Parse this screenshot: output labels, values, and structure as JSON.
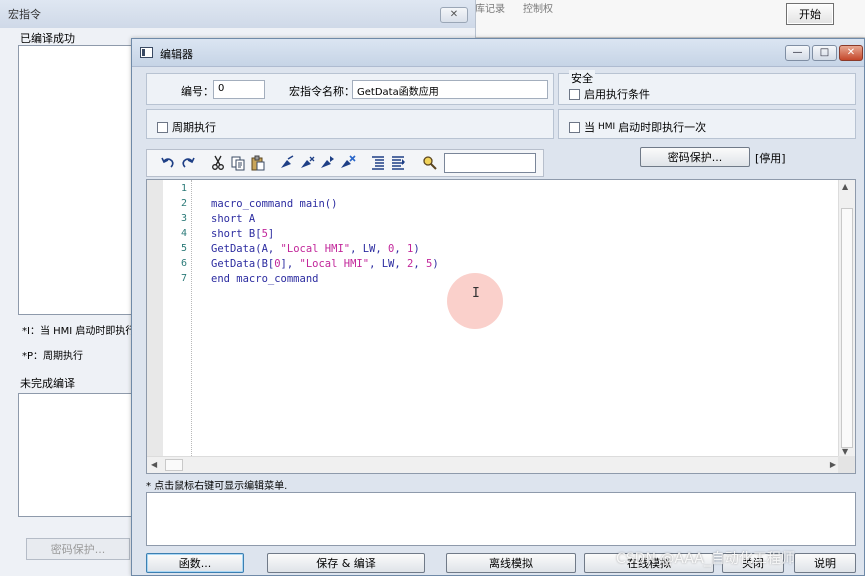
{
  "background_app": {
    "tabs": [
      "库记录",
      "控制权"
    ],
    "start_button": "开始"
  },
  "macro_window": {
    "title": "宏指令",
    "close_icon": "close-icon",
    "compiled_label": "已编译成功",
    "note_i": "*I：当 HMI 启动时即执行",
    "note_p": "*P：周期执行",
    "not_compiled_label": "未完成编译",
    "password_button": "密码保护..."
  },
  "editor": {
    "title": "编辑器",
    "window_controls": {
      "minimize": "—",
      "maximize": "□",
      "close": "✕"
    },
    "id_label": "编号：",
    "id_value": "0",
    "name_label": "宏指令名称：",
    "name_value": "GetData函数应用",
    "security_label": "安全",
    "enable_condition_label": "启用执行条件",
    "periodic_label": "周期执行",
    "run_once_prefix": "当",
    "run_once_hmi": "HMI",
    "run_once_suffix": "启动时即执行一次",
    "password_button": "密码保护...",
    "disabled_tag": "[停用]",
    "toolbar_icons": [
      "undo-icon",
      "redo-icon",
      "cut-icon",
      "copy-icon",
      "paste-icon",
      "bookmark-toggle-icon",
      "bookmark-next-icon",
      "bookmark-prev-icon",
      "bookmark-clear-icon",
      "indent-icon",
      "outdent-icon",
      "find-icon"
    ],
    "search_value": "",
    "code": {
      "line_numbers": [
        "1",
        "2",
        "3",
        "4",
        "5",
        "6",
        "7"
      ],
      "lines": [
        [
          {
            "t": ""
          }
        ],
        [
          {
            "t": "macro_command main()"
          }
        ],
        [
          {
            "t": "short A"
          }
        ],
        [
          {
            "t": "short B["
          },
          {
            "t": "5",
            "c": "num"
          },
          {
            "t": "]"
          }
        ],
        [
          {
            "t": "GetData(A, "
          },
          {
            "t": "\"Local HMI\"",
            "c": "str"
          },
          {
            "t": ", LW, "
          },
          {
            "t": "0",
            "c": "num"
          },
          {
            "t": ", "
          },
          {
            "t": "1",
            "c": "num"
          },
          {
            "t": ")"
          }
        ],
        [
          {
            "t": "GetData(B["
          },
          {
            "t": "0",
            "c": "num"
          },
          {
            "t": "], "
          },
          {
            "t": "\"Local HMI\"",
            "c": "str"
          },
          {
            "t": ", LW, "
          },
          {
            "t": "2",
            "c": "num"
          },
          {
            "t": ", "
          },
          {
            "t": "5",
            "c": "num"
          },
          {
            "t": ")"
          }
        ],
        [
          {
            "t": "end macro_command"
          }
        ]
      ]
    },
    "hint": "* 点击鼠标右键可显示编辑菜单.",
    "buttons": {
      "function": "函数...",
      "save_compile": "保存 & 编译",
      "offline_sim": "离线模拟",
      "online_sim": "在线模拟",
      "close": "关闭",
      "help": "说明"
    }
  },
  "watermark": "CSDN @AAA_自动化工程师",
  "colors": {
    "code_text": "#2c2ca0",
    "code_literal": "#c2269a",
    "line_number": "#2b7a78",
    "close_button": "#c4462a"
  }
}
